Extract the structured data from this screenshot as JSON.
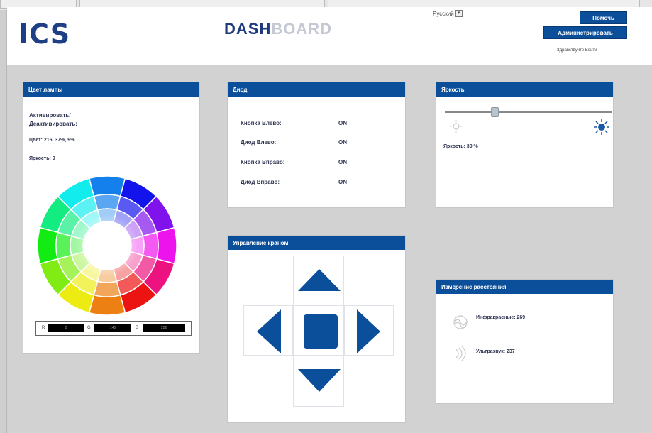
{
  "header": {
    "logo": "ICS",
    "title_part1": "DASH",
    "title_part2": "BOARD",
    "language": "Русский",
    "help_button": "Помочь",
    "admin_button": "Администрировать",
    "welcome": "Здравствуйте Войти"
  },
  "lamp_panel": {
    "title": "Цвет лампы",
    "activate_label_1": "Активировать/",
    "activate_label_2": "Деактивировать:",
    "color_value": "Цвет: 216, 37%, 9%",
    "brightness_value": "Яркость: 9",
    "r_label": "R",
    "r_value": "0",
    "g_label": "G",
    "g_value": "145",
    "b_label": "B",
    "b_value": "252"
  },
  "diode_panel": {
    "title": "Диод",
    "rows": [
      {
        "label": "Кнопка Влево:",
        "value": "ON"
      },
      {
        "label": "Диод Влево:",
        "value": "ON"
      },
      {
        "label": "Кнопка Вправо:",
        "value": "ON"
      },
      {
        "label": "Диод Вправо:",
        "value": "ON"
      }
    ]
  },
  "brightness_panel": {
    "title": "Яркость",
    "value_label": "Яркость: 30 %",
    "level_percent": 30
  },
  "crane_panel": {
    "title": "Управление краном"
  },
  "distance_panel": {
    "title": "Измерение расстояния",
    "infrared": "Инфракрасные: 269",
    "ultrasound": "Ультразвук: 237"
  },
  "colors": {
    "accent": "#0b4f9b",
    "background": "#d2d2d2"
  }
}
